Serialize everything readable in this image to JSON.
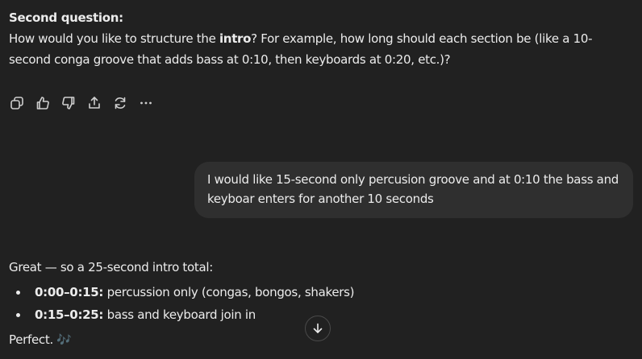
{
  "assistant_message": {
    "heading": "Second question:",
    "line_part1": "How would you like to structure the ",
    "line_bold": "intro",
    "line_part2": "? For example, how long should each section be (like a 10-second conga groove that adds bass at 0:10, then keyboards at 0:20, etc.)?"
  },
  "action_bar": {
    "icons": [
      "copy-icon",
      "thumbs-up-icon",
      "thumbs-down-icon",
      "share-icon",
      "regenerate-icon",
      "more-icon"
    ]
  },
  "user_message": {
    "text": "I would like 15-second only percusion groove and at 0:10 the bass and keyboar enters for another 10 seconds"
  },
  "reply": {
    "intro": "Great — so a 25-second intro total:",
    "items": [
      {
        "range": "0:00–0:15:",
        "text": " percussion only (congas, bongos, shakers)"
      },
      {
        "range": "0:15–0:25:",
        "text": " bass and keyboard join in"
      }
    ],
    "closing": "Perfect.",
    "closing_emoji": "🎶"
  },
  "scroll_button": {
    "icon": "arrow-down-icon"
  }
}
